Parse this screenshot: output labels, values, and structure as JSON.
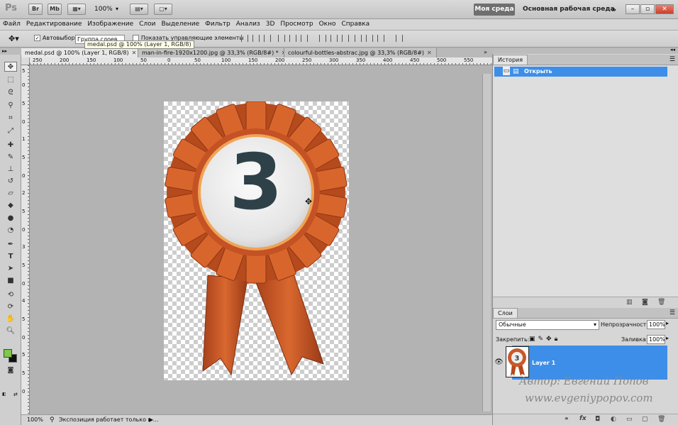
{
  "app": {
    "logo": "Ps",
    "bridge_btn": "Br",
    "minibridge_btn": "Mb",
    "zoom_value": "100%",
    "workspace_active": "Моя среда",
    "workspace_main": "Основная рабочая среда",
    "more": "»"
  },
  "menu": [
    "Файл",
    "Редактирование",
    "Изображение",
    "Слои",
    "Выделение",
    "Фильтр",
    "Анализ",
    "3D",
    "Просмотр",
    "Окно",
    "Справка"
  ],
  "options": {
    "autoselect_label": "Автовыбор:",
    "autoselect_value": "Группа слоев",
    "show_controls_label": "Показать управляющие элементы"
  },
  "tooltip": "medal.psd @ 100% (Layer 1, RGB/8)",
  "tabs": [
    {
      "label": "medal.psd @ 100% (Layer 1, RGB/8)",
      "close": "✕"
    },
    {
      "label": "man-in-fire-1920x1200.jpg @ 33,3% (RGB/8#) *",
      "close": "✕"
    },
    {
      "label": "colourful-bottles-abstrac.jpg @ 33,3% (RGB/8#)",
      "close": "✕"
    }
  ],
  "ruler_h": [
    "250",
    "200",
    "150",
    "100",
    "50",
    "0",
    "50",
    "100",
    "150",
    "200",
    "250",
    "300",
    "350",
    "400",
    "450",
    "500",
    "550"
  ],
  "ruler_v": [
    "5",
    "0",
    "5",
    "0",
    "1",
    "5",
    "0",
    "2",
    "5",
    "0",
    "3",
    "5",
    "0",
    "4",
    "5",
    "0",
    "5",
    "5",
    "0"
  ],
  "status": {
    "zoom": "100%",
    "info": "Экспозиция работает только в ..."
  },
  "history": {
    "tab": "История",
    "item": "Открыть"
  },
  "layers": {
    "tab": "Слои",
    "blend_mode": "Обычные",
    "opacity_label": "Непрозрачность:",
    "opacity_value": "100%",
    "lock_label": "Закрепить:",
    "fill_label": "Заливка:",
    "fill_value": "100%",
    "layer_name": "Layer 1"
  },
  "watermark": {
    "line1": "Автор: Евгений Попов",
    "line2": "www.evgeniypopov.com"
  },
  "medal": {
    "number": "3"
  },
  "colors": {
    "accent": "#3d8ee8",
    "medal_orange": "#d2622a",
    "foreground": "#7ec84a",
    "background": "#111111"
  }
}
